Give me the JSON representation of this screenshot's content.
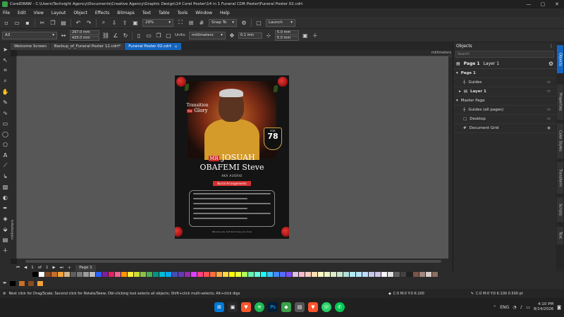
{
  "titlebar": {
    "title": "CorelDRAW - C:\\Users\\Techsight Agency\\Documents\\Creative Agency\\Graphic Design\\14 Corel Poster\\14 in 1 Funeral CDR Poster\\Funeral Poster 02.cdrt",
    "minimize": "—",
    "maximize": "▢",
    "close": "✕"
  },
  "menu": [
    "File",
    "Edit",
    "View",
    "Layout",
    "Object",
    "Effects",
    "Bitmaps",
    "Text",
    "Table",
    "Tools",
    "Window",
    "Help"
  ],
  "toolbar1": {
    "zoom": "29%",
    "snap": "Snap To",
    "launch": "Launch"
  },
  "toolbar2": {
    "page_size": "A3",
    "width": "297.0 mm",
    "height": "420.0 mm",
    "units_label": "Units:",
    "units": "millimeters",
    "nudge": "0.1 mm",
    "dup_x": "5.0 mm",
    "dup_y": "5.0 mm"
  },
  "tabs": [
    {
      "label": "Welcome Screen"
    },
    {
      "label": "Backup_of_Funeral Poster 12.cdrt*"
    },
    {
      "label": "Funeral Poster 02.cdrt"
    }
  ],
  "ruler": {
    "units": "millimeters"
  },
  "poster": {
    "transition": "Transition",
    "to": "TO",
    "glory": "Glory",
    "badge_for": "FOR",
    "badge_age": "78",
    "mr": "MR",
    "name_first": "JOSUAH",
    "name_last": "OBAFEMI Steve",
    "aka": "AKA AUSRIO",
    "arrangement": "Burial Arrangements",
    "footer": "We love you, but God loves you more"
  },
  "pagebar": {
    "current": "1",
    "of": "of",
    "total": "1",
    "page_tab": "Page 1"
  },
  "palette": [
    "#000000",
    "#ffffff",
    "#8a4b1f",
    "#c8702a",
    "#f2a33a",
    "#d4b48c",
    "#5e5e5e",
    "#7a7a7a",
    "#9c9c9c",
    "#bdbdbd",
    "#2962ff",
    "#7b1fa2",
    "#e91e63",
    "#f06292",
    "#ff9800",
    "#ffeb3b",
    "#cddc39",
    "#8bc34a",
    "#4caf50",
    "#009688",
    "#00bcd4",
    "#03a9f4",
    "#3f51b5",
    "#673ab7",
    "#9c27b0",
    "#e040fb",
    "#ff4081",
    "#ff5252",
    "#ff6e40",
    "#ffab40",
    "#ffd740",
    "#ffff00",
    "#eeff41",
    "#b2ff59",
    "#69f0ae",
    "#64ffda",
    "#18ffff",
    "#40c4ff",
    "#448aff",
    "#536dfe",
    "#7c4dff",
    "#e1bee7",
    "#f8bbd0",
    "#ffccbc",
    "#ffe0b2",
    "#fff9c4",
    "#f0f4c3",
    "#dcedc8",
    "#c8e6c9",
    "#b2dfdb",
    "#b2ebf2",
    "#b3e5fc",
    "#bbdefb",
    "#c5cae9",
    "#d1c4e9",
    "#f5f5f5",
    "#e0e0e0",
    "#616161",
    "#424242",
    "#212121",
    "#795548",
    "#a1887f",
    "#d7ccc8",
    "#8d6e63"
  ],
  "status": {
    "hint": "Next click for Drag/Scale; Second click for Rotate/Skew; Dbl-clicking tool selects all objects; Shift+click multi-selects; Alt+click digs",
    "fill": "C:0 M:0 Y:0 K:100",
    "outline": "C:0 M:0 Y:0 K:100  0.500 pt"
  },
  "objects": {
    "title": "Objects",
    "search_placeholder": "Search",
    "page_label": "Page 1",
    "layer_label": "Layer 1",
    "rows": [
      {
        "label": "Page 1"
      },
      {
        "label": "Guides"
      },
      {
        "label": "Layer 1"
      },
      {
        "label": "Master Page"
      },
      {
        "label": "Guides (all pages)"
      },
      {
        "label": "Desktop"
      },
      {
        "label": "Document Grid"
      }
    ]
  },
  "dock_tabs": [
    "Objects",
    "Properties",
    "Color Styles",
    "Transform",
    "Scripts",
    "Text"
  ],
  "taskbar": {
    "time": "4:10 PM",
    "date": "8/14/2026",
    "lang": "ENG",
    "notif": "13"
  }
}
